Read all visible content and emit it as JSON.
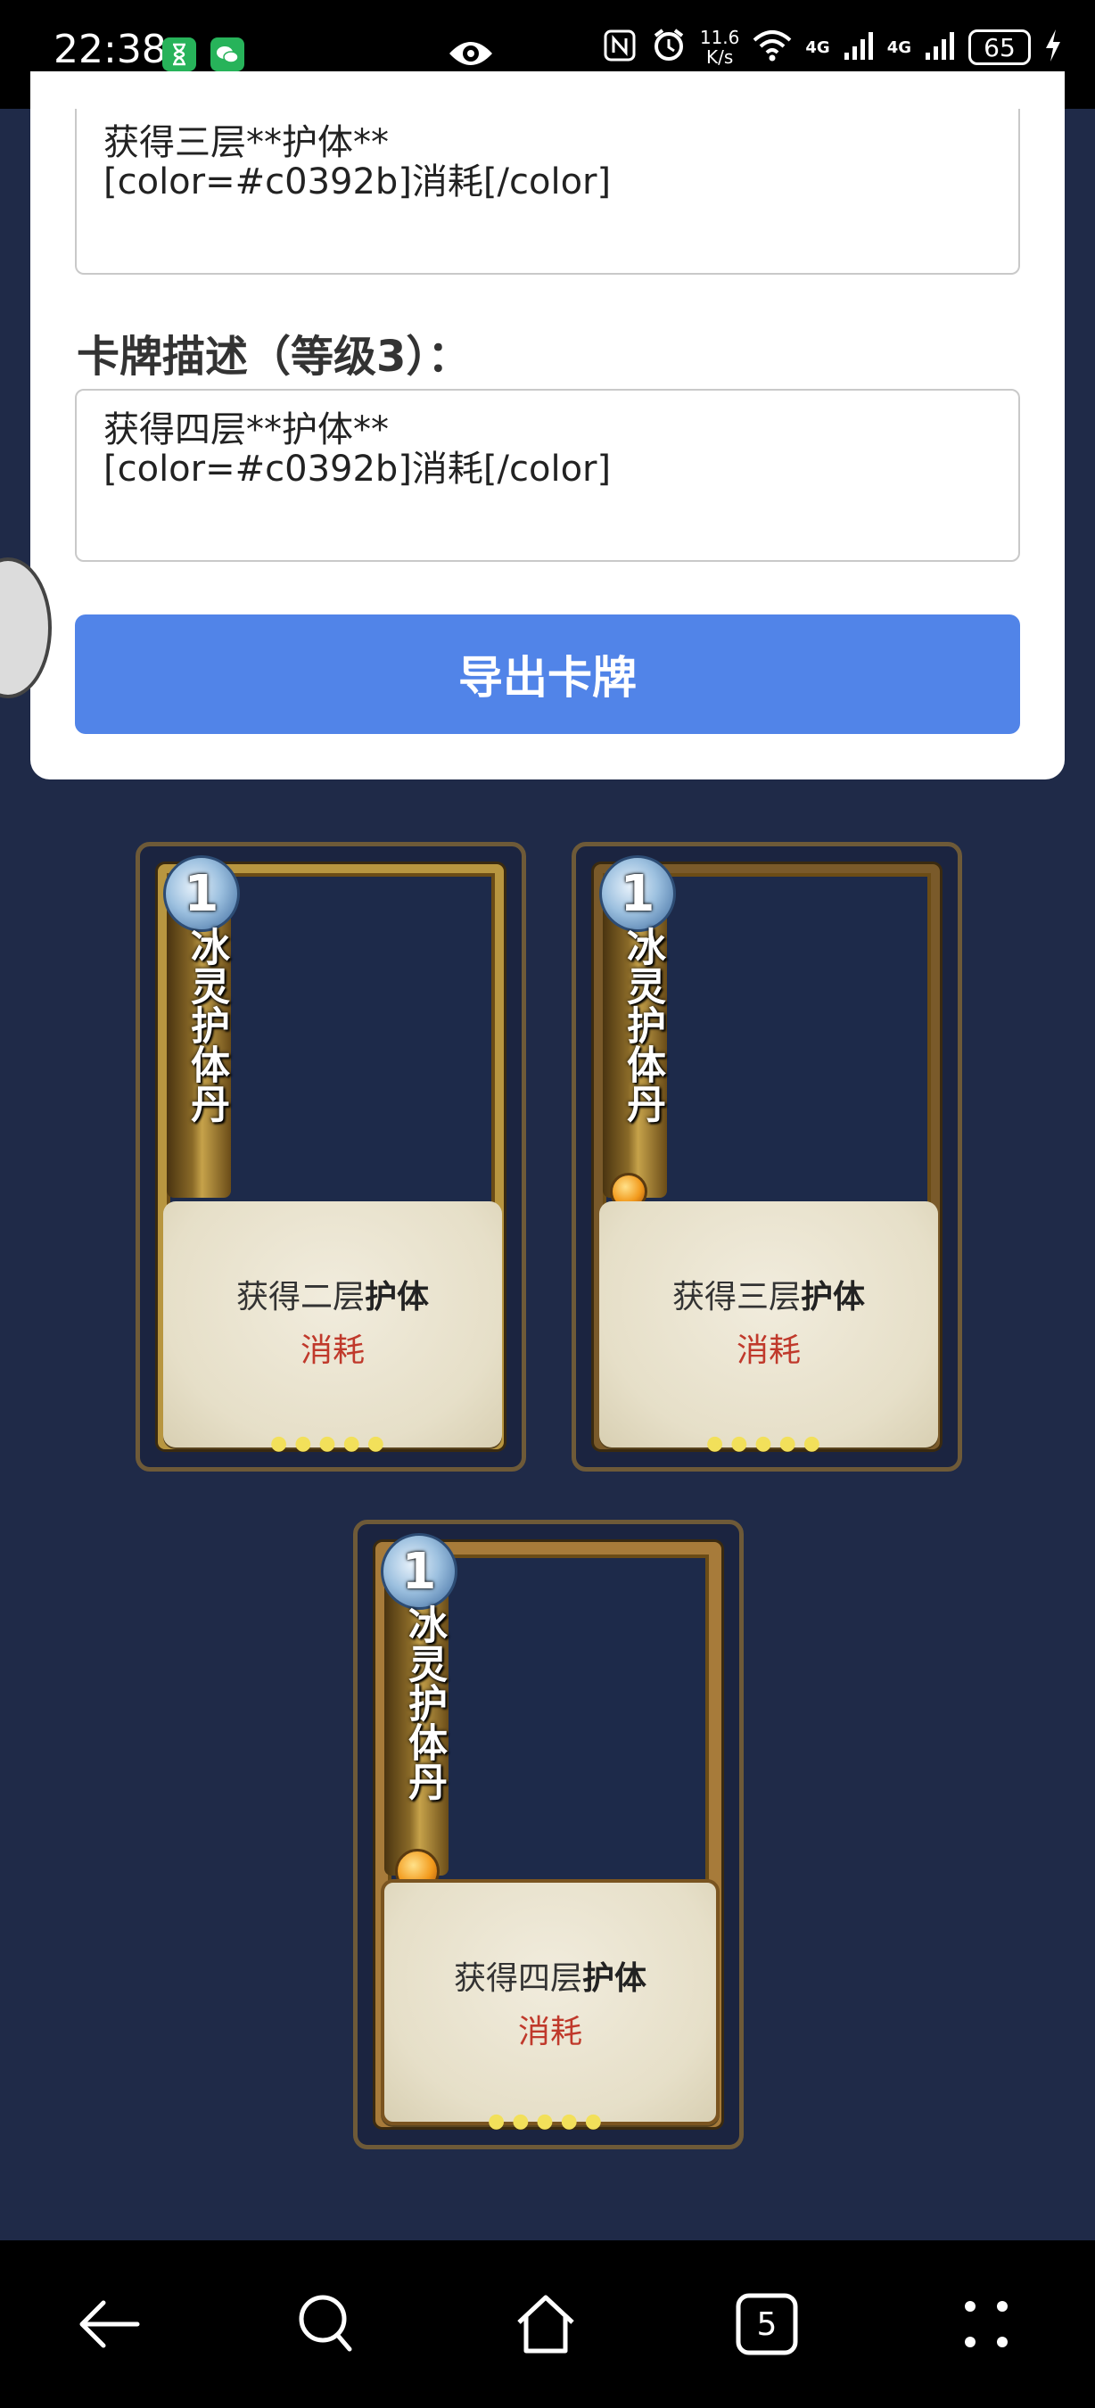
{
  "status_bar": {
    "time": "22:38",
    "speed_value": "11.6",
    "speed_unit": "K/s",
    "network_1": "4G",
    "network_2": "4G",
    "battery": "65",
    "icons": [
      "hourglass-icon",
      "wechat-icon",
      "eye-icon",
      "nfc-icon",
      "alarm-icon",
      "wifi-icon",
      "signal-icon",
      "signal-icon",
      "battery-icon",
      "charging-icon"
    ]
  },
  "form": {
    "desc_level2_value": "获得三层**护体**\n[color=#c0392b]消耗[/color]",
    "label_level3": "卡牌描述（等级3）：",
    "desc_level3_value": "获得四层**护体**\n[color=#c0392b]消耗[/color]",
    "export_button": "导出卡牌"
  },
  "cards": [
    {
      "cost": "1",
      "name": "冰灵护体丹",
      "desc_prefix": "获得二层",
      "desc_bold": "护体",
      "consume": "消耗",
      "dots": "●●●●●"
    },
    {
      "cost": "1",
      "name": "冰灵护体丹",
      "desc_prefix": "获得三层",
      "desc_bold": "护体",
      "consume": "消耗",
      "dots": "●●●●●"
    },
    {
      "cost": "1",
      "name": "冰灵护体丹",
      "desc_prefix": "获得四层",
      "desc_bold": "护体",
      "consume": "消耗",
      "dots": "●●●●●"
    }
  ],
  "colors": {
    "page_bg": "#1f2a48",
    "button_bg": "#5184e8",
    "consume_red": "#c0392b"
  },
  "nav_bar": {
    "tab_count": "5",
    "icons": [
      "back-icon",
      "search-icon",
      "home-icon",
      "tabs-icon",
      "menu-icon"
    ]
  }
}
